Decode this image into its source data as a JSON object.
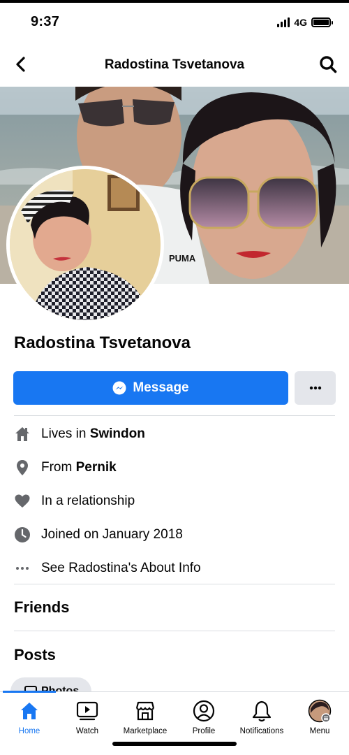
{
  "status": {
    "time": "9:37",
    "network": "4G"
  },
  "header": {
    "title": "Radostina Tsvetanova",
    "back_icon": "chevron-left-icon",
    "search_icon": "search-icon"
  },
  "cover": {
    "brand_text": "PUMA"
  },
  "profile": {
    "name": "Radostina Tsvetanova",
    "message_label": "Message",
    "more_label": "···"
  },
  "about": {
    "lives_prefix": "Lives in ",
    "lives_value": "Swindon",
    "from_prefix": "From ",
    "from_value": "Pernik",
    "relationship": "In a relationship",
    "joined": "Joined on January 2018",
    "see_about": "See Radostina's About Info"
  },
  "sections": {
    "friends": "Friends",
    "posts": "Posts",
    "photos_chip": "Photos"
  },
  "tabs": [
    {
      "label": "Home",
      "icon": "home-icon",
      "active": true
    },
    {
      "label": "Watch",
      "icon": "watch-icon",
      "active": false
    },
    {
      "label": "Marketplace",
      "icon": "marketplace-icon",
      "active": false
    },
    {
      "label": "Profile",
      "icon": "profile-icon",
      "active": false
    },
    {
      "label": "Notifications",
      "icon": "bell-icon",
      "active": false
    },
    {
      "label": "Menu",
      "icon": "menu-avatar-icon",
      "active": false
    }
  ],
  "colors": {
    "accent": "#1877f2",
    "icon_gray": "#65676b",
    "button_gray": "#e4e6eb"
  }
}
